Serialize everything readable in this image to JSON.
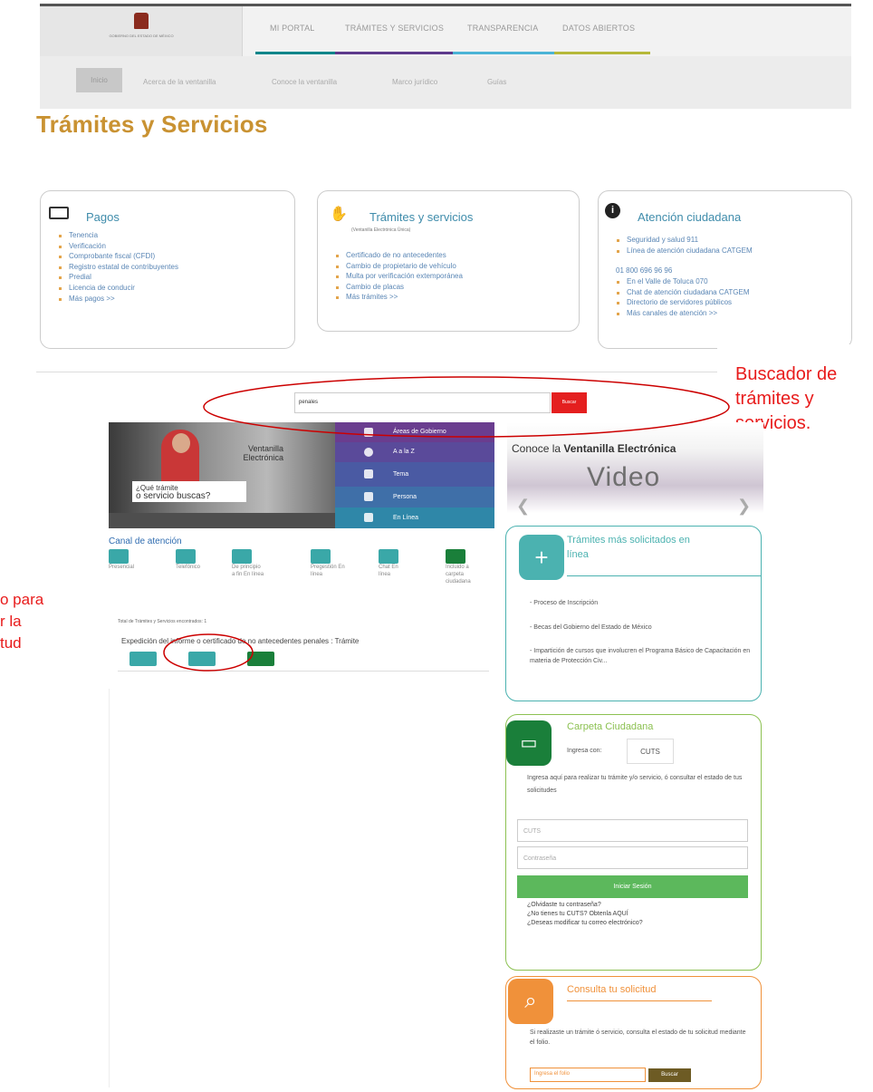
{
  "header": {
    "logo_text": "GOBIERNO DEL ESTADO DE MÉXICO",
    "nav": [
      {
        "label": "MI PORTAL",
        "color": "#00858a"
      },
      {
        "label": "TRÁMITES Y SERVICIOS",
        "color": "#5d3a8c"
      },
      {
        "label": "TRANSPARENCIA",
        "color": "#4bb4d6"
      },
      {
        "label": "DATOS ABIERTOS",
        "color": "#b6b83a"
      }
    ]
  },
  "subnav": {
    "items": [
      "Inicio",
      "Acerca de la ventanilla",
      "Conoce la ventanilla",
      "Marco jurídico",
      "Guías"
    ]
  },
  "page_title": "Trámites y Servicios",
  "cards": {
    "pagos": {
      "title": "Pagos",
      "items": [
        "Tenencia",
        "Verificación",
        "Comprobante fiscal (CFDI)",
        "Registro estatal de contribuyentes",
        "Predial",
        "Licencia de conducir",
        "Más pagos >>"
      ]
    },
    "tramites": {
      "title": "Trámites y servicios",
      "subtitle": "(Ventanilla Electrónica Única)",
      "items": [
        "Certificado de no antecedentes",
        "Cambio de propietario de vehículo",
        "Multa por verificación extemporánea",
        "Cambio de placas",
        "Más trámites >>"
      ]
    },
    "atencion": {
      "title": "Atención ciudadana",
      "items": [
        "Seguridad y salud 911",
        "Línea de atención ciudadana CATGEM",
        "En el Valle de Toluca 070",
        "Chat de atención ciudadana CATGEM",
        "Directorio de servidores públicos",
        "Más canales de atención >>"
      ],
      "phone": "01 800 696 96 96"
    }
  },
  "annotations": {
    "buscador": [
      "Buscador de",
      "trámites y",
      "servicios."
    ],
    "acceso": [
      "o para",
      "r la",
      "tud"
    ]
  },
  "search": {
    "value": "penales",
    "button": "Buscar"
  },
  "banner": {
    "logo_line1": "Ventanilla",
    "logo_line2": "Electrónica",
    "question_line1": "¿Qué trámite",
    "question_line2": "o servicio buscas?",
    "menu": [
      {
        "label": "Áreas de Gobierno",
        "color": "#6a3d8f"
      },
      {
        "label": "A a la Z",
        "color": "#5a4a9a"
      },
      {
        "label": "Tema",
        "color": "#4a5aa3"
      },
      {
        "label": "Persona",
        "color": "#3f6fa8"
      },
      {
        "label": "En Línea",
        "color": "#2f87a8"
      }
    ]
  },
  "video": {
    "title_pre": "Conoce la ",
    "title_bold": "Ventanilla Electrónica",
    "word": "Video"
  },
  "canal": {
    "title": "Canal de atención",
    "items": [
      {
        "label": "Presencial",
        "color": "#3aa8a8"
      },
      {
        "label": "Telefónico",
        "color": "#3aa8a8"
      },
      {
        "label": "De principio a fin En línea",
        "color": "#3aa8a8"
      },
      {
        "label": "Pregestión En línea",
        "color": "#3aa8a8"
      },
      {
        "label": "Chat En línea",
        "color": "#3aa8a8"
      },
      {
        "label": "Incluido a carpeta ciudadana",
        "color": "#1a7f3a"
      }
    ]
  },
  "results": {
    "count_text": "Total de Trámites y Servicios encontrados: 1",
    "item": "Expedición del informe o certificado de no antecedentes penales : Trámite"
  },
  "mas_solicitados": {
    "title_line1": "Trámites más solicitados en",
    "title_line2": "línea",
    "items": [
      "- Proceso de Inscripción",
      "- Becas del Gobierno del Estado de México",
      "- Impartición de cursos que involucren el Programa Básico de Capacitación en materia de Protección Civ..."
    ],
    "color": "#4bb2b0"
  },
  "carpeta": {
    "title": "Carpeta Ciudadana",
    "ingresa_con": "Ingresa con:",
    "cuts_badge": "CUTS",
    "desc": "Ingresa aquí para realizar tu trámite y/o servicio, ó consultar el estado de tus solicitudes",
    "cuts_placeholder": "CUTS",
    "pass_placeholder": "Contraseña",
    "login_btn": "Iniciar Sesión",
    "links": [
      "¿Olvidaste tu contraseña?",
      "¿No tienes tu CUTS? Obtenla AQUÍ",
      "¿Deseas modificar tu correo electrónico?"
    ],
    "color": "#8cc152"
  },
  "consulta": {
    "title": "Consulta tu solicitud",
    "desc": "Si realizaste un trámite ó servicio, consulta el estado de tu solicitud mediante el folio.",
    "placeholder": "Ingresa el folio",
    "button": "Buscar",
    "color": "#f0913a"
  }
}
